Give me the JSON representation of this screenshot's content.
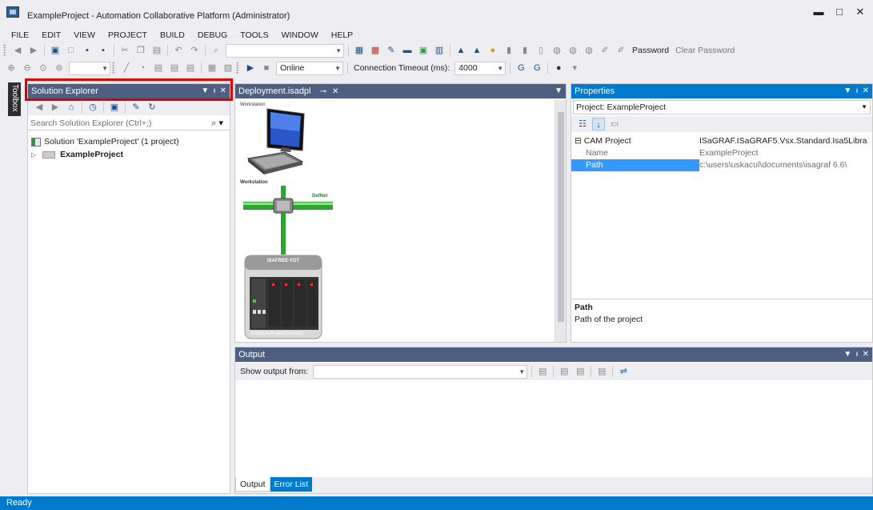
{
  "window": {
    "title": "ExampleProject - Automation Collaborative Platform (Administrator)",
    "minimize": "▬",
    "maximize": "□",
    "close": "✕"
  },
  "menu": [
    "FILE",
    "EDIT",
    "VIEW",
    "PROJECT",
    "BUILD",
    "DEBUG",
    "TOOLS",
    "WINDOW",
    "HELP"
  ],
  "toolbar": {
    "password_label": "Password",
    "clear_password_label": "Clear Password",
    "online_value": "Online",
    "timeout_label": "Connection Timeout (ms):",
    "timeout_value": "4000"
  },
  "toolbox": {
    "label": "Toolbox"
  },
  "solution_explorer": {
    "title": "Solution Explorer",
    "search_placeholder": "Search Solution Explorer (Ctrl+;)",
    "solution_label": "Solution 'ExampleProject' (1 project)",
    "project_label": "ExampleProject"
  },
  "deployment": {
    "tab_title": "Deployment.isadpl",
    "workstation_label_top": "Workstation",
    "workstation_label": "Workstation",
    "network_label": "DefNet",
    "target_label": "ISAFREE-TGT",
    "device_label": "ExampleProject.Device1"
  },
  "properties": {
    "title": "Properties",
    "object": "Project: ExampleProject",
    "rows": [
      {
        "name": "CAM Project",
        "value": "ISaGRAF.ISaGRAF5.Vsx.Standard.Isa5Libra"
      },
      {
        "name": "Name",
        "value": "ExampleProject"
      },
      {
        "name": "Path",
        "value": "c:\\users\\uskacul\\documents\\isagraf 6.6\\"
      }
    ],
    "description_title": "Path",
    "description_text": "Path of the project"
  },
  "output": {
    "title": "Output",
    "show_from_label": "Show output from:",
    "tabs": [
      "Output",
      "Error List"
    ]
  },
  "status": {
    "text": "Ready"
  },
  "colors": {
    "accent": "#007acc",
    "inactive_header": "#4d6082",
    "highlight": "#e00000"
  }
}
